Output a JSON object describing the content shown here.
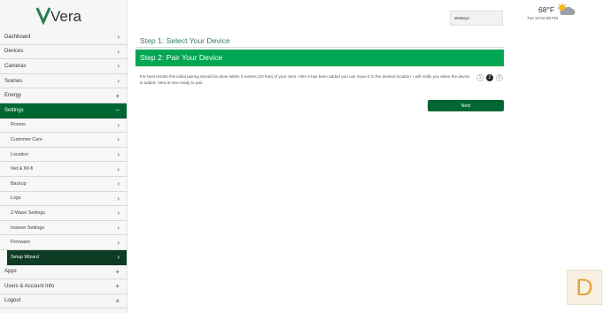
{
  "brand": {
    "logo_text": "Vera",
    "accent": "#006633",
    "green": "#00a651"
  },
  "topbar": {
    "temperature": "68°F",
    "datetime": "Tue 10:02:35 PM",
    "user_name": "Webeye"
  },
  "sidebar": {
    "items": [
      {
        "label": "Dashboard",
        "icon": "chevron-right"
      },
      {
        "label": "Devices",
        "icon": "chevron-right"
      },
      {
        "label": "Cameras",
        "icon": "chevron-right"
      },
      {
        "label": "Scenes",
        "icon": "chevron-right"
      },
      {
        "label": "Energy",
        "icon": "plus"
      },
      {
        "label": "Settings",
        "icon": "minus"
      },
      {
        "label": "Rooms",
        "icon": "chevron-right"
      },
      {
        "label": "Customer Care",
        "icon": "chevron-right"
      },
      {
        "label": "Location",
        "icon": "chevron-right"
      },
      {
        "label": "Net & Wi-fi",
        "icon": "chevron-right"
      },
      {
        "label": "Backup",
        "icon": "chevron-right"
      },
      {
        "label": "Logs",
        "icon": "chevron-right"
      },
      {
        "label": "Z-Wave Settings",
        "icon": "chevron-right"
      },
      {
        "label": "Insteon Settings",
        "icon": "chevron-right"
      },
      {
        "label": "Firmware",
        "icon": "chevron-right"
      },
      {
        "label": "Setup Wizard",
        "icon": "chevron-right"
      },
      {
        "label": "Apps",
        "icon": "plus"
      },
      {
        "label": "Users & Account Info",
        "icon": "plus"
      },
      {
        "label": "Logout",
        "icon": "close"
      }
    ]
  },
  "main": {
    "step1_title": "Step 1: Select Your Device",
    "step2_title": "Step 2: Pair Your Device",
    "instructions": "For best results this initial pairing should be done within 3 meters (10 feet) of your Vera. After it has been added you can move it to the desired location. I will notify you when the device is added. Vera is now ready to pair.",
    "pager": [
      "1",
      "2",
      "3"
    ],
    "active_page": "2",
    "next_label": "Next"
  },
  "corner_badge": "D"
}
